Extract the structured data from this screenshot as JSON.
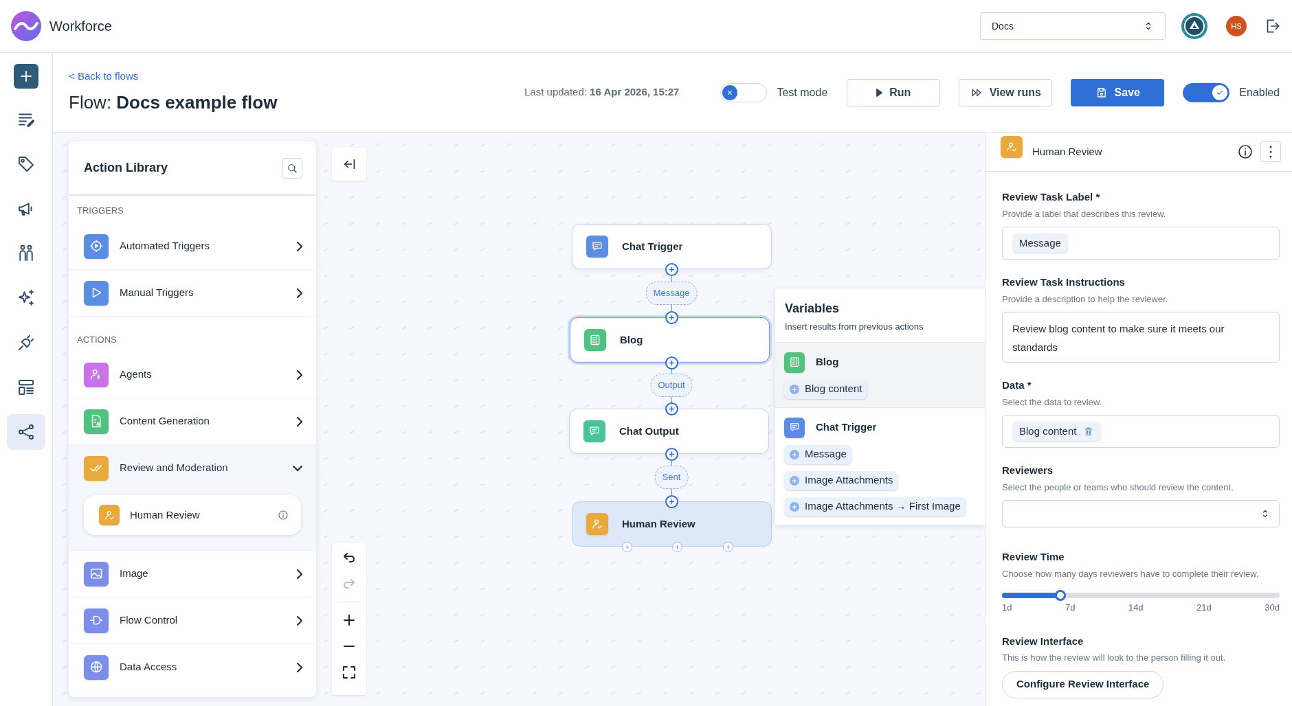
{
  "app": {
    "name": "Workforce"
  },
  "workspace_select": {
    "value": "Docs"
  },
  "user": {
    "initials": "HS"
  },
  "rail": [
    {
      "selected": false
    },
    {
      "selected": false
    },
    {
      "selected": false
    },
    {
      "selected": false
    },
    {
      "selected": false
    },
    {
      "selected": false
    },
    {
      "selected": false
    },
    {
      "selected": true
    }
  ],
  "flow_header": {
    "back_link": "< Back to flows",
    "title": "Flow: **Docs example flow**",
    "last_updated": "Last updated: **16 Apr 2026, 15:27**",
    "test_mode": {
      "label": "Test mode",
      "on": false
    },
    "buttons": [
      {
        "label": "Run",
        "kind": "run"
      },
      {
        "label": "View runs",
        "kind": "runs"
      },
      {
        "label": "Save",
        "kind": "save"
      }
    ],
    "enabled": {
      "label": "Enabled",
      "on": true
    }
  },
  "action_library": {
    "title": "Action Library",
    "sections": [
      {
        "heading": "TRIGGERS",
        "items": [
          {
            "label": "Automated Triggers",
            "color": "#5b8ee3",
            "expanded": false
          },
          {
            "label": "Manual Triggers",
            "color": "#5b8ee3",
            "expanded": false
          }
        ]
      },
      {
        "heading": "ACTIONS",
        "items": [
          {
            "label": "Agents",
            "color": "#c873e6",
            "expanded": false
          },
          {
            "label": "Content Generation",
            "color": "#4fc27f",
            "expanded": false
          },
          {
            "label": "Review and Moderation",
            "color": "#e9a93c",
            "expanded": true,
            "children": [
              {
                "label": "Human Review",
                "color": "#e9a93c"
              }
            ]
          },
          {
            "label": "Image",
            "color": "#7c8ee8",
            "expanded": false
          },
          {
            "label": "Flow Control",
            "color": "#7c8ee8",
            "expanded": false
          },
          {
            "label": "Data Access",
            "color": "#7c8ee8",
            "expanded": false
          }
        ]
      }
    ]
  },
  "nodes": [
    {
      "label": "Chat Trigger",
      "color": "#5b8ee3",
      "selected": false,
      "focused": false
    },
    {
      "label": "Blog",
      "color": "#4fc27f",
      "selected": false,
      "focused": true
    },
    {
      "label": "Chat Output",
      "color": "#4cc29a",
      "selected": false,
      "focused": false
    },
    {
      "label": "Human Review",
      "color": "#e9a93c",
      "selected": true,
      "focused": false
    }
  ],
  "edges": [
    "Message",
    "Output",
    "Sent"
  ],
  "variables": {
    "title": "Variables",
    "subtitle": "Insert results from previous actions",
    "groups": [
      {
        "label": "Blog",
        "color": "#4fc27f",
        "hovered": true,
        "chips": [
          "Blog content"
        ]
      },
      {
        "label": "Chat Trigger",
        "color": "#5b8ee3",
        "hovered": false,
        "chips": [
          "Message",
          "Image Attachments",
          "Image Attachments → First Image"
        ]
      }
    ]
  },
  "right_panel": {
    "title": "Human Review",
    "color": "#e9a93c",
    "fields": [
      {
        "kind": "chips",
        "label": "Review Task Label *",
        "hint": "Provide a label that describes this review.",
        "chips": [
          {
            "label": "Message",
            "removable": false
          }
        ]
      },
      {
        "kind": "text",
        "label": "Review Task Instructions",
        "hint": "Provide a description to help the reviewer.",
        "value": "Review blog content to make sure it meets our standards"
      },
      {
        "kind": "chips",
        "label": "Data *",
        "hint": "Select the data to review.",
        "chips": [
          {
            "label": "Blog content",
            "removable": true
          }
        ]
      },
      {
        "kind": "select",
        "label": "Reviewers",
        "hint": "Select the people or teams who should review the content."
      },
      {
        "kind": "slider",
        "label": "Review Time",
        "hint": "Choose how many days reviewers have to complete their review.",
        "level": 0.21,
        "ticks": [
          "1d",
          "7d",
          "14d",
          "21d",
          "30d"
        ]
      },
      {
        "kind": "button",
        "label": "Review Interface",
        "hint": "This is how the review will look to the person filling it out.",
        "button": "Configure Review Interface"
      }
    ]
  }
}
